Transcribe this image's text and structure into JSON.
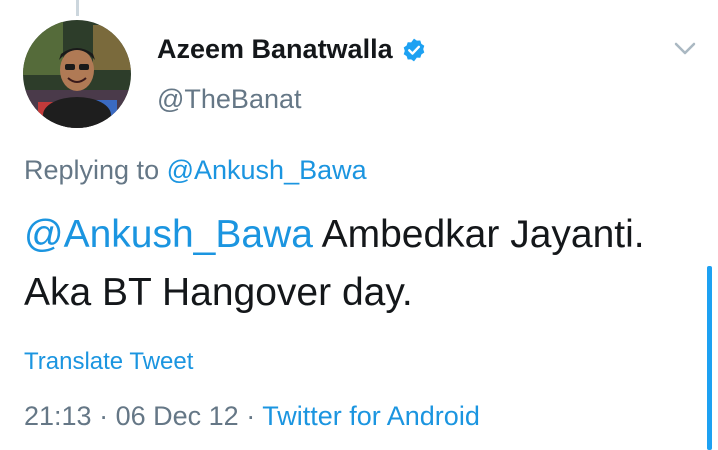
{
  "user": {
    "display_name": "Azeem Banatwalla",
    "handle": "@TheBanat",
    "verified_icon": "verified-badge-icon",
    "avatar_icon": "avatar-photo"
  },
  "reply": {
    "prefix": "Replying to",
    "mention": "@Ankush_Bawa"
  },
  "tweet": {
    "mention": "@Ankush_Bawa",
    "text": " Ambedkar Jayanti. Aka BT Hangover day."
  },
  "translate_label": "Translate Tweet",
  "meta": {
    "time": "21:13",
    "date": "06 Dec 12",
    "separator": "·",
    "source": "Twitter for Android"
  },
  "colors": {
    "link": "#1b95e0",
    "secondary_text": "#657786",
    "primary_text": "#14171a",
    "verified": "#1da1f2"
  }
}
